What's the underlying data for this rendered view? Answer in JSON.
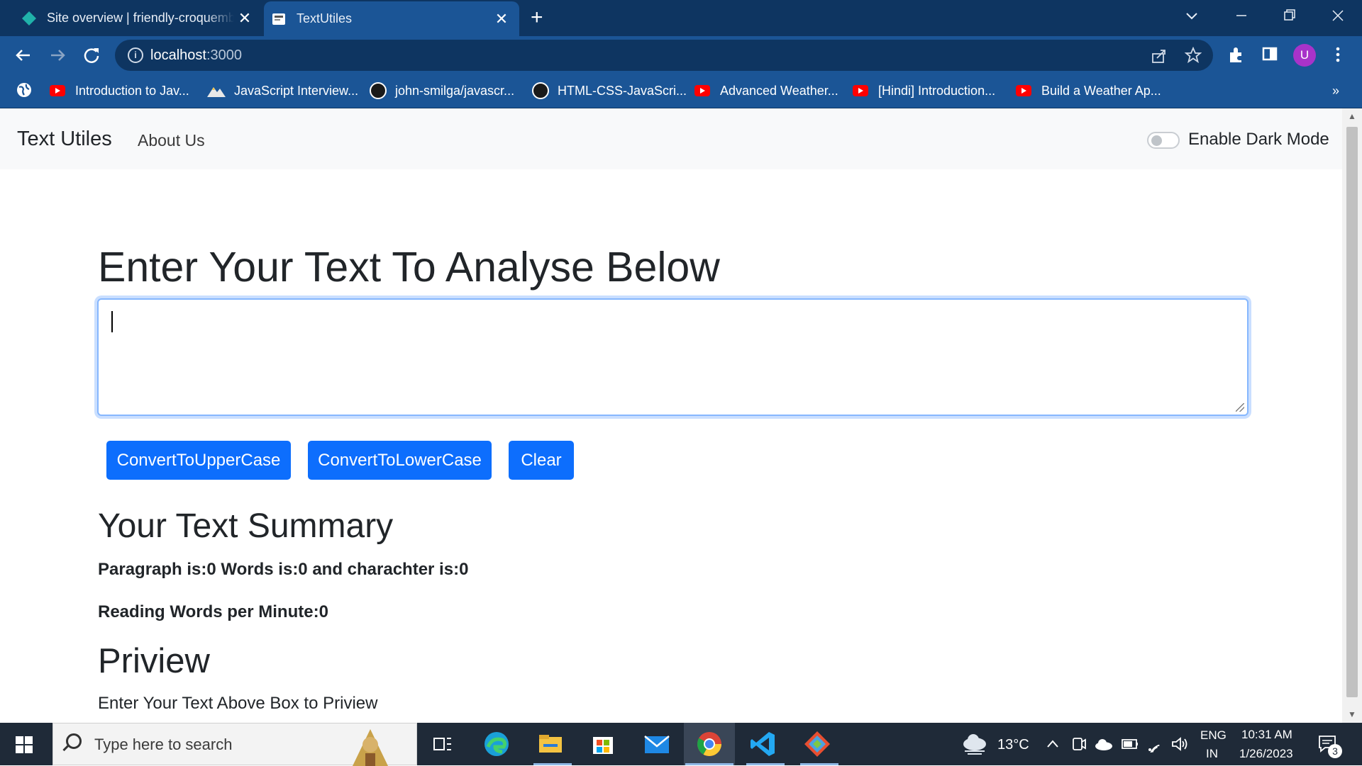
{
  "browser": {
    "tabs": [
      {
        "title": "Site overview | friendly-croquembouche",
        "close": "✕"
      },
      {
        "title": "TextUtiles",
        "close": "✕"
      }
    ],
    "new_tab": "+",
    "url_host": "localhost",
    "url_port": ":3000",
    "avatar_letter": "U",
    "bookmarks": [
      {
        "label": "Introduction to Jav...",
        "icon": "youtube-icon"
      },
      {
        "label": "JavaScript Interview...",
        "icon": "mountain-icon"
      },
      {
        "label": "john-smilga/javascr...",
        "icon": "github-icon"
      },
      {
        "label": "HTML-CSS-JavaScri...",
        "icon": "github-icon"
      },
      {
        "label": "Advanced Weather...",
        "icon": "youtube-icon"
      },
      {
        "label": "[Hindi] Introduction...",
        "icon": "youtube-icon"
      },
      {
        "label": "Build a Weather Ap...",
        "icon": "youtube-icon"
      }
    ],
    "bookmarks_overflow": "»"
  },
  "app": {
    "navbar": {
      "brand": "Text Utiles",
      "about": "About Us",
      "dark_mode_label": "Enable Dark Mode",
      "dark_mode_on": false
    },
    "heading": "Enter Your Text To Analyse Below",
    "textarea_value": "",
    "buttons": {
      "upper": "ConvertToUpperCase",
      "lower": "ConvertToLowerCase",
      "clear": "Clear"
    },
    "summary_heading": "Your Text Summary",
    "summary_line": "Paragraph is:0 Words is:0 and charachter is:0",
    "reading_line": "Reading Words per Minute:0",
    "preview_heading": "Priview",
    "preview_text": "Enter Your Text Above Box to Priview"
  },
  "taskbar": {
    "search_placeholder": "Type here to search",
    "temperature": "13°C",
    "language": "ENG",
    "region": "IN",
    "time": "10:31 AM",
    "date": "1/26/2023",
    "notification_count": "3"
  },
  "colors": {
    "tabbar": "#0e3561",
    "toolbar": "#1b5596",
    "primary_button": "#0d6efd",
    "taskbar": "#1f2a38"
  }
}
